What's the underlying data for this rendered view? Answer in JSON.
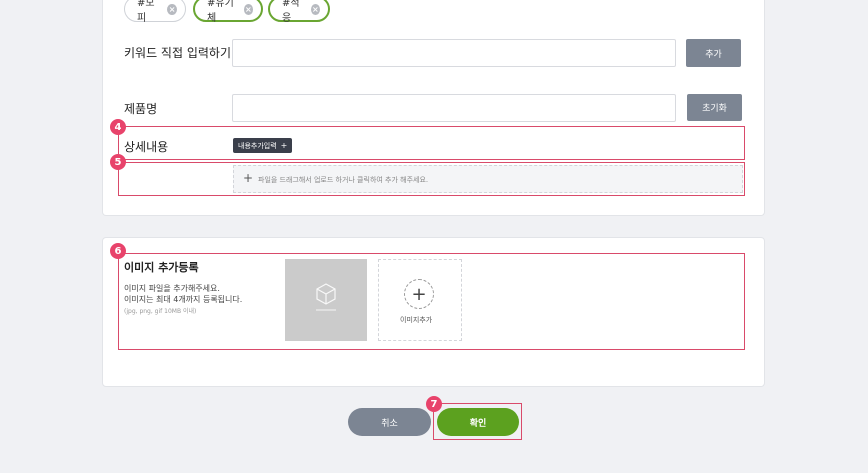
{
  "tags": [
    {
      "label": "#모피",
      "remove": "×"
    },
    {
      "label": "#유기체",
      "remove": "×"
    },
    {
      "label": "#적응",
      "remove": "×"
    }
  ],
  "keyword": {
    "label": "키워드 직접 입력하기",
    "value": "",
    "add_button": "추가"
  },
  "product": {
    "label": "제품명",
    "value": "",
    "reset_button": "초기화"
  },
  "detail": {
    "label": "상세내용",
    "chip": "내용추가입력",
    "chip_plus": "+"
  },
  "dropzone": {
    "plus": "+",
    "text": "파일을 드래그해서 업로드 하거나 클릭하여 추가 해주세요."
  },
  "images": {
    "title": "이미지 추가등록",
    "desc1": "이미지 파일을 추가해주세요.",
    "desc2": "이미지는 최대 4개까지 등록됩니다.",
    "desc3": "(jpg, png, gif 10MB 이내)",
    "add_plus": "+",
    "add_label": "이미지추가"
  },
  "badges": [
    "4",
    "5",
    "6",
    "7"
  ],
  "actions": {
    "cancel": "취소",
    "confirm": "확인"
  },
  "colors": {
    "accent_green": "#5ca11f",
    "badge": "#e8436b",
    "highlight": "#d94a6a",
    "button_gray": "#7c8593"
  }
}
